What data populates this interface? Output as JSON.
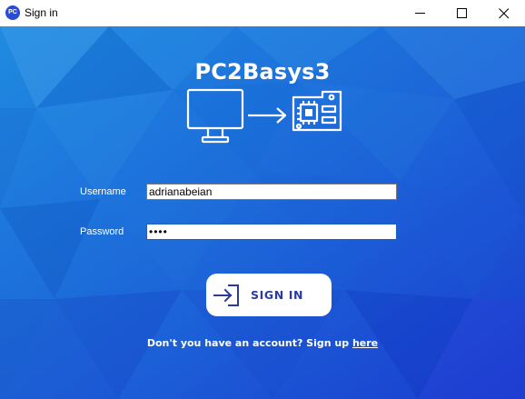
{
  "window": {
    "icon_text": "PC",
    "title": "Sign in"
  },
  "brand": {
    "title": "PC2Basys3"
  },
  "form": {
    "username_label": "Username",
    "username_value": "adrianabeian",
    "password_label": "Password",
    "password_value": "••••"
  },
  "signin_button": {
    "label": "SIGN IN"
  },
  "signup": {
    "prompt": "Don't you have an account? Sign up",
    "link": "here"
  },
  "colors": {
    "background_top": "#1f87dc",
    "background_bottom": "#1b3fd2",
    "button_text": "#2b3aa0"
  }
}
